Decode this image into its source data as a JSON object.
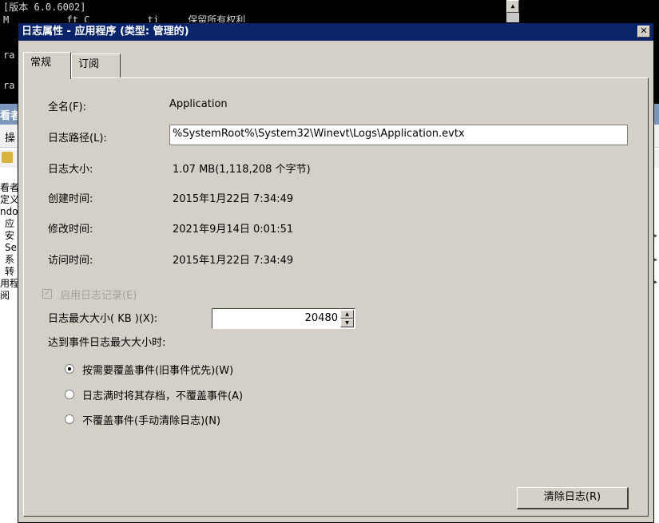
{
  "console": {
    "line1": "[版本 6.0.6002]",
    "line2": "M          ft C          ti     保留所有权利",
    "line3": "ra",
    "line4": "ra"
  },
  "mmc": {
    "title_fragment": "看者",
    "menu_fragment": "操",
    "tree_items": [
      "看者",
      "定义",
      "ndov",
      "应",
      "安",
      "Se",
      "系",
      "转",
      "用程",
      "阅"
    ]
  },
  "dialog": {
    "title": "日志属性 - 应用程序 (类型: 管理的)",
    "close_glyph": "✕",
    "tabs": [
      "常规",
      "订阅"
    ],
    "full_name_label": "全名(F):",
    "full_name_value": "Application",
    "log_path_label": "日志路径(L):",
    "log_path_value": "%SystemRoot%\\System32\\Winevt\\Logs\\Application.evtx",
    "log_size_label": "日志大小:",
    "log_size_value": "1.07 MB(1,118,208 个字节)",
    "created_label": "创建时间:",
    "created_value": "2015年1月22日 7:34:49",
    "modified_label": "修改时间:",
    "modified_value": "2021年9月14日 0:01:51",
    "accessed_label": "访问时间:",
    "accessed_value": "2015年1月22日 7:34:49",
    "enable_logging_label": "启用日志记录(E)",
    "enable_logging_checked": true,
    "max_size_label": "日志最大大小( KB )(X):",
    "max_size_value": "20480",
    "when_max_label": "达到事件日志最大大小时:",
    "radio_options": [
      "按需要覆盖事件(旧事件优先)(W)",
      "日志满时将其存档，不覆盖事件(A)",
      "不覆盖事件(手动清除日志)(N)"
    ],
    "selected_option": 0,
    "clear_button": "清除日志(R)"
  },
  "colors": {
    "dialog_title_bg": "#0a246a",
    "dialog_bg": "#d4d0c8",
    "disabled_text": "#a0a0a0"
  }
}
